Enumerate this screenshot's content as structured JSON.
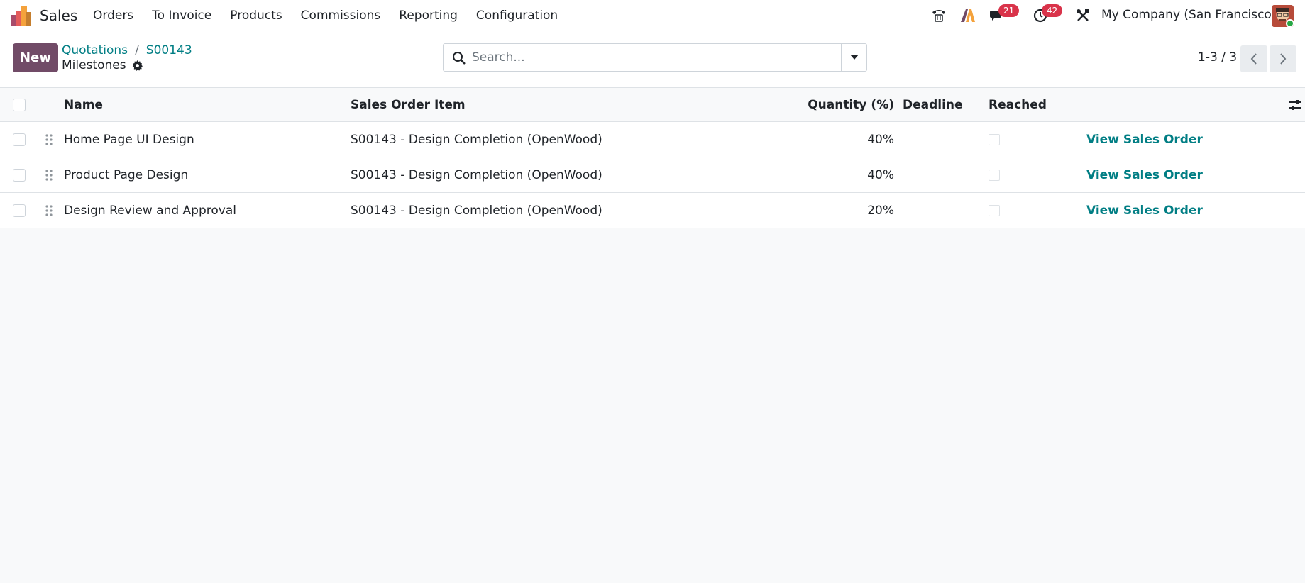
{
  "navbar": {
    "app_name": "Sales",
    "menu": [
      "Orders",
      "To Invoice",
      "Products",
      "Commissions",
      "Reporting",
      "Configuration"
    ],
    "messages_count": "21",
    "activities_count": "42",
    "company": "My Company (San Francisco)"
  },
  "control": {
    "new_label": "New",
    "breadcrumb": [
      "Quotations",
      "S00143"
    ],
    "breadcrumb_sep": "/",
    "title": "Milestones",
    "search_placeholder": "Search...",
    "pager": "1-3 / 3"
  },
  "list": {
    "columns": {
      "name": "Name",
      "sale_line": "Sales Order Item",
      "quantity": "Quantity (%)",
      "deadline": "Deadline",
      "reached": "Reached"
    },
    "rows": [
      {
        "name": "Home Page UI Design",
        "sale_line": "S00143 - Design Completion (OpenWood)",
        "quantity": "40%",
        "deadline": "",
        "reached": false,
        "action": "View Sales Order"
      },
      {
        "name": "Product Page Design",
        "sale_line": "S00143 - Design Completion (OpenWood)",
        "quantity": "40%",
        "deadline": "",
        "reached": false,
        "action": "View Sales Order"
      },
      {
        "name": "Design Review and Approval",
        "sale_line": "S00143 - Design Completion (OpenWood)",
        "quantity": "20%",
        "deadline": "",
        "reached": false,
        "action": "View Sales Order"
      }
    ]
  },
  "colors": {
    "brand": "#714b67",
    "link": "#017e84",
    "badge": "#d9334a"
  }
}
